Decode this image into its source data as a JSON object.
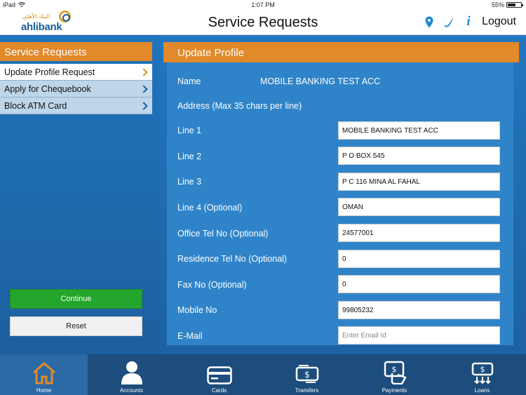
{
  "status_bar": {
    "device": "iPad",
    "time": "1:07 PM",
    "battery": "55%"
  },
  "header": {
    "title": "Service Requests",
    "logo_brand": "ahlibank",
    "logo_arabic": "البنك الأهلي",
    "logout_label": "Logout",
    "icons": [
      "location-pin-icon",
      "phone-icon",
      "info-icon"
    ]
  },
  "sidebar": {
    "title": "Service Requests",
    "items": [
      {
        "label": "Update Profile Request",
        "active": true
      },
      {
        "label": "Apply for Chequebook",
        "active": false
      },
      {
        "label": "Block ATM Card",
        "active": false
      }
    ],
    "continue_label": "Continue",
    "reset_label": "Reset"
  },
  "form": {
    "title": "Update Profile",
    "name_label": "Name",
    "name_value": "MOBILE BANKING TEST ACC",
    "address_note": "Address (Max 35 chars per line)",
    "fields": [
      {
        "label": "Line 1",
        "value": "MOBILE BANKING TEST ACC"
      },
      {
        "label": "Line 2",
        "value": "P O BOX 545"
      },
      {
        "label": "Line 3",
        "value": "P C 116 MINA AL FAHAL"
      },
      {
        "label": "Line 4 (Optional)",
        "value": "OMAN"
      },
      {
        "label": "Office Tel No (Optional)",
        "value": "24577001"
      },
      {
        "label": "Residence Tel No (Optional)",
        "value": "0"
      },
      {
        "label": "Fax No (Optional)",
        "value": "0"
      },
      {
        "label": "Mobile No",
        "value": "99805232"
      },
      {
        "label": "E-Mail",
        "value": "",
        "placeholder": "Enter Email Id"
      }
    ]
  },
  "tabbar": {
    "tabs": [
      {
        "label": "Home",
        "icon": "home-icon",
        "active": true
      },
      {
        "label": "Accounts",
        "icon": "person-icon",
        "active": false
      },
      {
        "label": "Cards",
        "icon": "card-icon",
        "active": false
      },
      {
        "label": "Transfers",
        "icon": "transfer-icon",
        "active": false
      },
      {
        "label": "Payments",
        "icon": "payment-icon",
        "active": false
      },
      {
        "label": "Loans",
        "icon": "loan-icon",
        "active": false
      }
    ]
  },
  "colors": {
    "accent_orange": "#e2892a",
    "brand_blue": "#1d5f9d",
    "continue_green": "#24a52b"
  }
}
